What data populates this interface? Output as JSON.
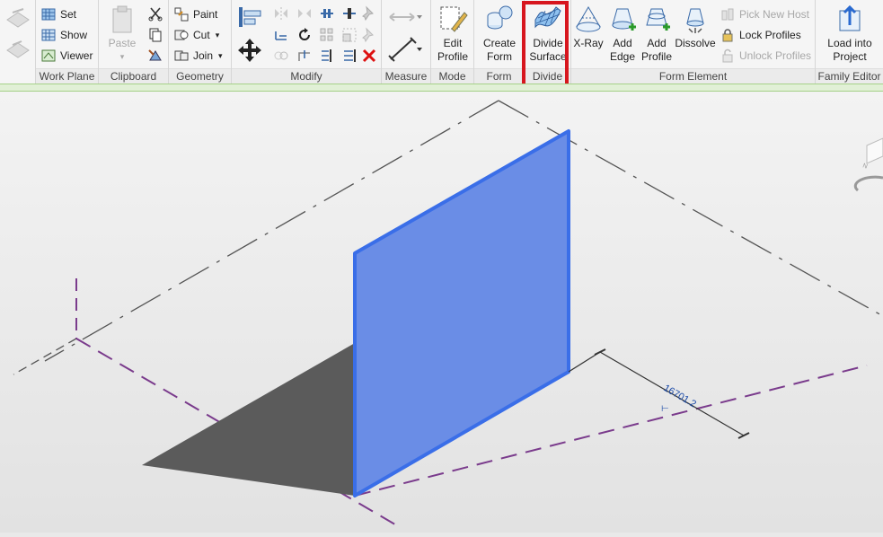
{
  "ribbon": {
    "work_plane": {
      "title": "Work Plane",
      "set": "Set",
      "show": "Show",
      "viewer": "Viewer"
    },
    "clipboard": {
      "title": "Clipboard",
      "paste": "Paste"
    },
    "geometry": {
      "title": "Geometry",
      "paint": "Paint",
      "cut": "Cut",
      "join": "Join"
    },
    "modify": {
      "title": "Modify"
    },
    "measure": {
      "title": "Measure"
    },
    "mode": {
      "title": "Mode",
      "edit_profile_line1": "Edit",
      "edit_profile_line2": "Profile"
    },
    "form": {
      "title": "Form",
      "create_form_line1": "Create",
      "create_form_line2": "Form"
    },
    "divide": {
      "title": "Divide",
      "divide_surface_line1": "Divide",
      "divide_surface_line2": "Surface",
      "highlighted": true,
      "highlight_color": "#d7161e"
    },
    "form_element": {
      "title": "Form Element",
      "xray": "X-Ray",
      "add_edge_line1": "Add",
      "add_edge_line2": "Edge",
      "add_profile_line1": "Add",
      "add_profile_line2": "Profile",
      "dissolve": "Dissolve",
      "pick_new_host": "Pick New Host",
      "lock_profiles": "Lock Profiles",
      "unlock_profiles": "Unlock Profiles"
    },
    "family_editor": {
      "title": "Family Editor",
      "load_line1": "Load into",
      "load_line2": "Project"
    }
  },
  "viewport": {
    "dimension_label": "16701.2",
    "surface_color": "#6a8de6",
    "surface_edge_color": "#3a6ee8",
    "shadow_color": "#5b5b5b",
    "reference_plane_color": "#7a3b8c"
  }
}
